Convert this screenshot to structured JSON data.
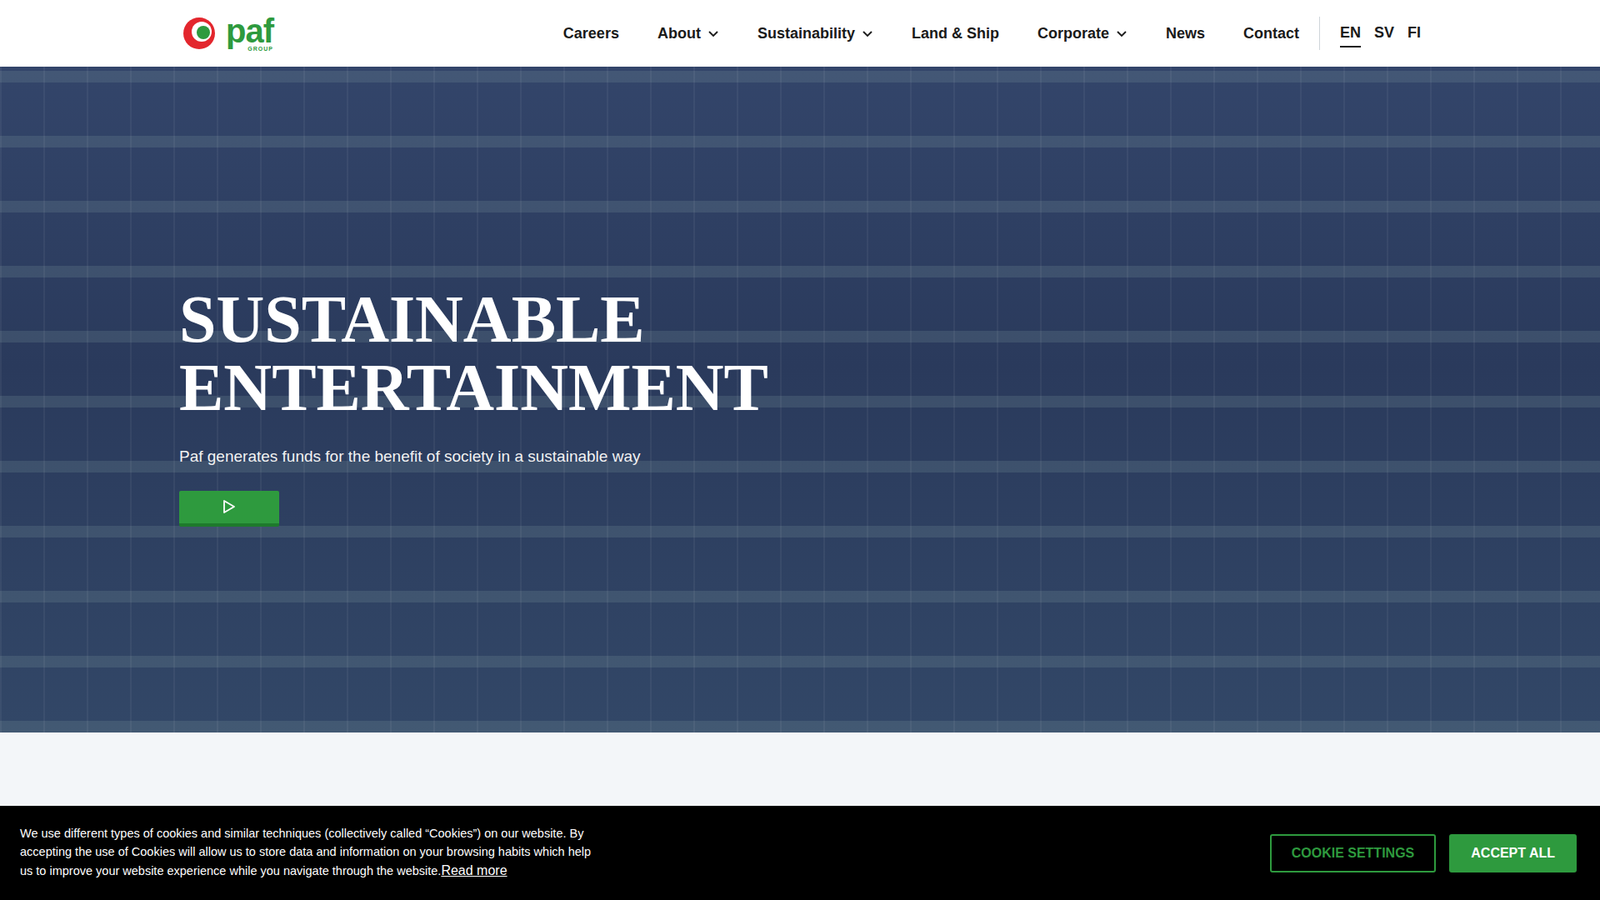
{
  "logo": {
    "text": "paf",
    "sub": "GROUP"
  },
  "nav": {
    "items": [
      {
        "label": "Careers",
        "dropdown": false
      },
      {
        "label": "About",
        "dropdown": true
      },
      {
        "label": "Sustainability",
        "dropdown": true
      },
      {
        "label": "Land & Ship",
        "dropdown": false
      },
      {
        "label": "Corporate",
        "dropdown": true
      },
      {
        "label": "News",
        "dropdown": false
      },
      {
        "label": "Contact",
        "dropdown": false
      }
    ]
  },
  "languages": [
    {
      "label": "EN",
      "selected": true
    },
    {
      "label": "SV",
      "selected": false
    },
    {
      "label": "FI",
      "selected": false
    }
  ],
  "hero": {
    "title": [
      "SUSTAINABLE",
      "ENTERTAINMENT"
    ],
    "subtitle": "Paf generates funds for the benefit of society in a sustainable way"
  },
  "cookie": {
    "text": "We use different types of cookies and similar techniques (collectively called “Cookies”) on our website. By accepting the use of Cookies will allow us to store data and information on your browsing habits which help us to improve your website experience while you navigate through the website.",
    "link": "Read more",
    "buttons": [
      "COOKIE SETTINGS",
      "ACCEPT ALL"
    ]
  }
}
